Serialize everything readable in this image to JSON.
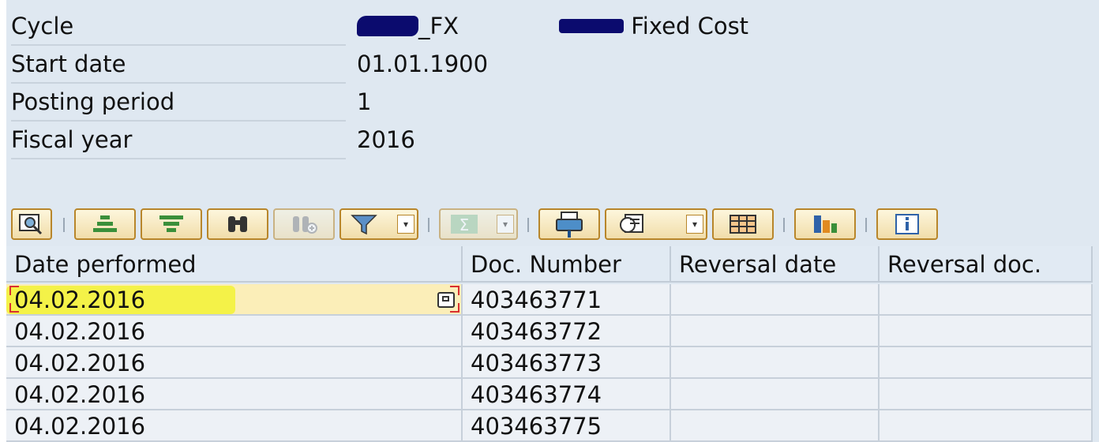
{
  "header": {
    "cycle_label": "Cycle",
    "cycle_value_suffix": "_FX",
    "cycle_desc": "Fixed Cost",
    "start_date_label": "Start date",
    "start_date_value": "01.01.1900",
    "posting_period_label": "Posting period",
    "posting_period_value": "1",
    "fiscal_year_label": "Fiscal year",
    "fiscal_year_value": "2016"
  },
  "toolbar": {
    "buttons": [
      {
        "icon": "details-icon"
      },
      {
        "icon": "sort-ascending-icon"
      },
      {
        "icon": "sort-descending-icon"
      },
      {
        "icon": "find-icon"
      },
      {
        "icon": "find-next-icon",
        "disabled": true
      },
      {
        "icon": "filter-icon"
      },
      {
        "icon": "sum-icon",
        "disabled": true
      },
      {
        "icon": "print-preview-icon"
      },
      {
        "icon": "export-icon"
      },
      {
        "icon": "layout-icon"
      },
      {
        "icon": "graphic-icon"
      },
      {
        "icon": "info-icon"
      }
    ]
  },
  "table": {
    "columns": [
      "Date performed",
      "Doc. Number",
      "Reversal date",
      "Reversal doc."
    ],
    "rows": [
      {
        "date": "04.02.2016",
        "doc": "403463771",
        "rev_date": "",
        "rev_doc": ""
      },
      {
        "date": "04.02.2016",
        "doc": "403463772",
        "rev_date": "",
        "rev_doc": ""
      },
      {
        "date": "04.02.2016",
        "doc": "403463773",
        "rev_date": "",
        "rev_doc": ""
      },
      {
        "date": "04.02.2016",
        "doc": "403463774",
        "rev_date": "",
        "rev_doc": ""
      },
      {
        "date": "04.02.2016",
        "doc": "403463775",
        "rev_date": "",
        "rev_doc": ""
      }
    ]
  },
  "colors": {
    "background": "#dfe8f1",
    "button_border": "#b8862b",
    "highlight": "#f3f23c",
    "redaction": "#0b0b6e"
  }
}
